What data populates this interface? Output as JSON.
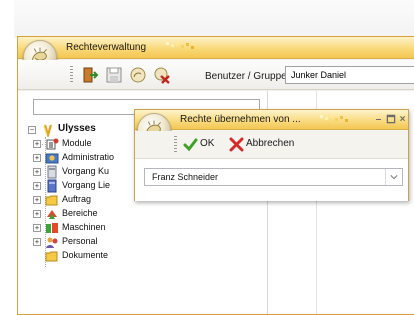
{
  "main_window": {
    "title": "Rechteverwaltung",
    "toolbar": {
      "user_group_label": "Benutzer / Gruppe",
      "user_group_value": "Junker Daniel"
    }
  },
  "tree": {
    "root": {
      "label": "Ulysses",
      "expander": "−"
    },
    "items": [
      {
        "label": "Module",
        "icon": "module-icon",
        "expander": "+"
      },
      {
        "label": "Administratio",
        "icon": "admin-icon",
        "expander": "+"
      },
      {
        "label": "Vorgang Ku",
        "icon": "document-grey-icon",
        "expander": "+"
      },
      {
        "label": "Vorgang Lie",
        "icon": "document-blue-icon",
        "expander": "+"
      },
      {
        "label": "Auftrag",
        "icon": "folder-icon",
        "expander": "+"
      },
      {
        "label": "Bereiche",
        "icon": "areas-icon",
        "expander": "+"
      },
      {
        "label": "Maschinen",
        "icon": "machines-icon",
        "expander": "+"
      },
      {
        "label": "Personal",
        "icon": "personal-icon",
        "expander": "+"
      },
      {
        "label": "Dokumente",
        "icon": "folder-icon",
        "expander": ""
      }
    ]
  },
  "dialog": {
    "title": "Rechte übernehmen von ...",
    "ok_label": "OK",
    "cancel_label": "Abbrechen",
    "selected_user": "Franz Schneider"
  },
  "colors": {
    "title_gold": "#f9d97a",
    "border_gold": "#d8a23a",
    "ok_green": "#3fa02a",
    "cancel_red": "#d62a2a"
  }
}
